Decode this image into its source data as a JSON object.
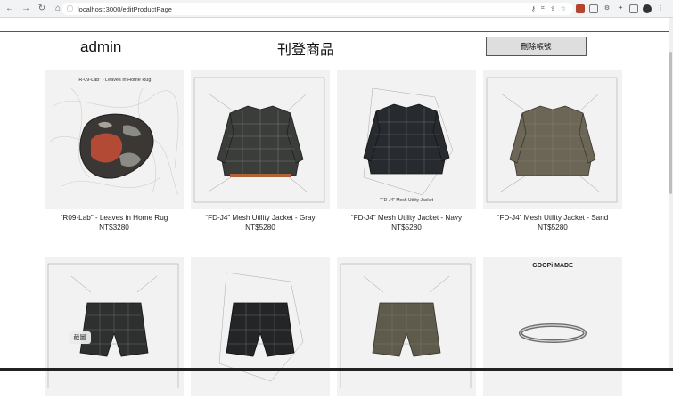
{
  "browser": {
    "url": "localhost:3000/editProductPage"
  },
  "header": {
    "brand": "admin",
    "title": "刊登商品",
    "delete_account": "刪除帳號"
  },
  "products": [
    {
      "name": "“R09-Lab” - Leaves in Home Rug",
      "price": "NT$3280",
      "kind": "rug",
      "caption": "“R-09-Lab” - Leaves in Home Rug"
    },
    {
      "name": "“FD-J4” Mesh Utility Jacket - Gray",
      "price": "NT$5280",
      "kind": "jacket-gray",
      "caption": ""
    },
    {
      "name": "“FD-J4” Mesh Utility Jacket - Navy",
      "price": "NT$5280",
      "kind": "jacket-navy",
      "caption": "“FD-J4” Mesh Utility Jacket"
    },
    {
      "name": "“FD-J4” Mesh Utility Jacket - Sand",
      "price": "NT$5280",
      "kind": "jacket-sand",
      "caption": ""
    },
    {
      "name": "",
      "price": "",
      "kind": "shorts-gray",
      "caption": ""
    },
    {
      "name": "",
      "price": "",
      "kind": "shorts-navy",
      "caption": ""
    },
    {
      "name": "",
      "price": "",
      "kind": "shorts-sand",
      "caption": ""
    },
    {
      "name": "",
      "price": "",
      "kind": "bracelet",
      "caption": "GOOPi MADE"
    }
  ],
  "overlay": {
    "screenshot_label": "截圖"
  },
  "colors": {
    "jacket_gray": "#3b3d3b",
    "jacket_navy": "#272a2e",
    "jacket_sand": "#6b6656"
  }
}
